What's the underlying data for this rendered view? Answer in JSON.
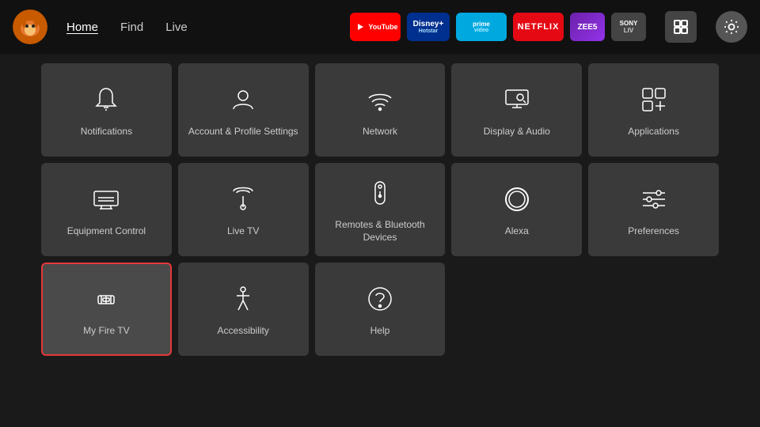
{
  "nav": {
    "links": [
      {
        "label": "Home",
        "active": true
      },
      {
        "label": "Find",
        "active": false
      },
      {
        "label": "Live",
        "active": false
      }
    ],
    "apps": [
      {
        "label": "YouTube",
        "class": "app-youtube"
      },
      {
        "label": "Disney+\nHotstar",
        "class": "app-disney"
      },
      {
        "label": "prime video",
        "class": "app-prime"
      },
      {
        "label": "NETFLIX",
        "class": "app-netflix"
      },
      {
        "label": "ZEE5",
        "class": "app-zee5"
      },
      {
        "label": "SONY\nLIV",
        "class": "app-sony"
      }
    ]
  },
  "grid": {
    "rows": [
      [
        {
          "id": "notifications",
          "label": "Notifications"
        },
        {
          "id": "account-profile",
          "label": "Account & Profile Settings"
        },
        {
          "id": "network",
          "label": "Network"
        },
        {
          "id": "display-audio",
          "label": "Display & Audio"
        },
        {
          "id": "applications",
          "label": "Applications"
        }
      ],
      [
        {
          "id": "equipment-control",
          "label": "Equipment Control"
        },
        {
          "id": "live-tv",
          "label": "Live TV"
        },
        {
          "id": "remotes-bluetooth",
          "label": "Remotes & Bluetooth Devices"
        },
        {
          "id": "alexa",
          "label": "Alexa"
        },
        {
          "id": "preferences",
          "label": "Preferences"
        }
      ],
      [
        {
          "id": "my-fire-tv",
          "label": "My Fire TV",
          "selected": true
        },
        {
          "id": "accessibility",
          "label": "Accessibility"
        },
        {
          "id": "help",
          "label": "Help"
        },
        {
          "id": "empty1",
          "label": "",
          "empty": true
        },
        {
          "id": "empty2",
          "label": "",
          "empty": true
        }
      ]
    ]
  }
}
